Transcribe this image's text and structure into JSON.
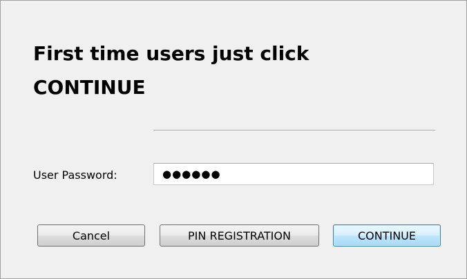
{
  "dialog": {
    "heading": "First time users just click CONTINUE"
  },
  "password": {
    "label": "User Password:",
    "masked_value": "●●●●●●"
  },
  "buttons": {
    "cancel": "Cancel",
    "pin_registration": "PIN REGISTRATION",
    "continue": "CONTINUE"
  },
  "colors": {
    "dialog_background": "#f0f0f0",
    "default_button_border": "#3c7fb1",
    "default_button_fill": "#bee6fd"
  }
}
